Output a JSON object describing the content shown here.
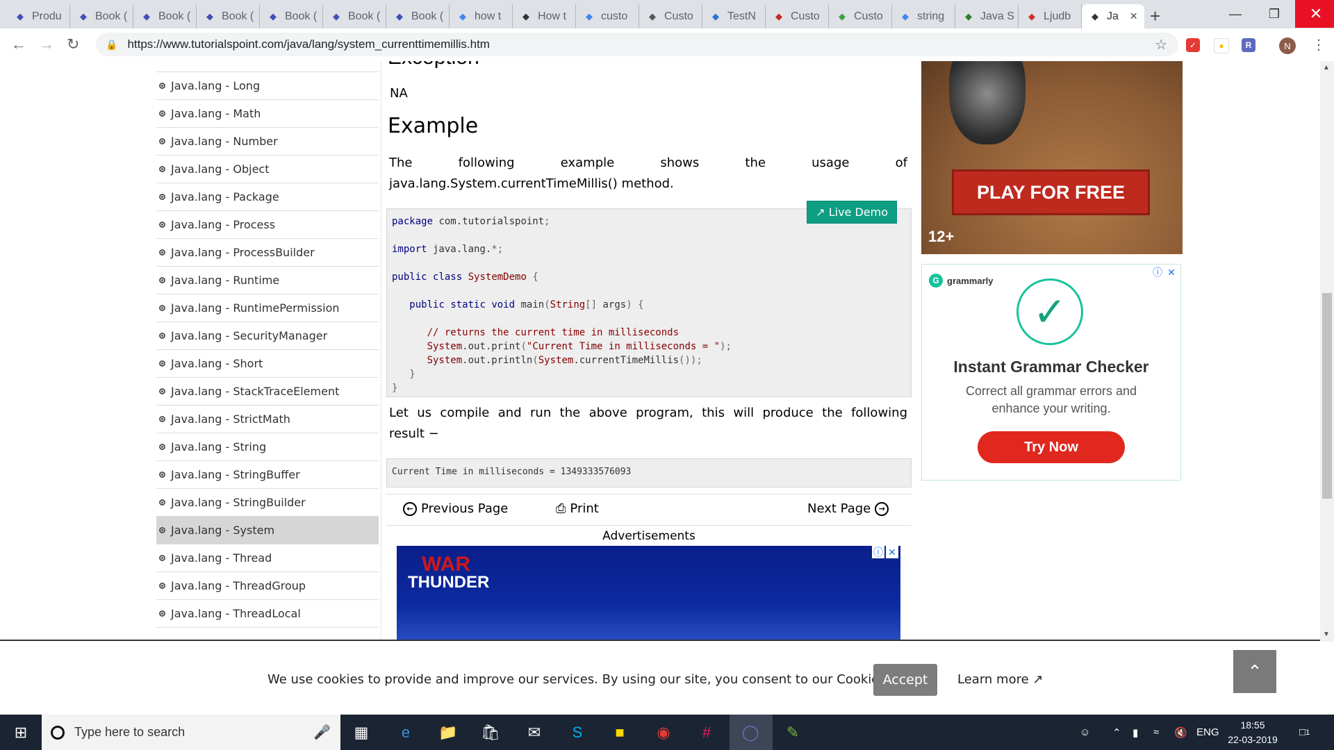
{
  "browser": {
    "tabs": [
      {
        "label": "Produ",
        "icon": "app-icon",
        "color": "#3f51b5"
      },
      {
        "label": "Book (",
        "icon": "app-icon",
        "color": "#3f51b5"
      },
      {
        "label": "Book (",
        "icon": "app-icon",
        "color": "#3f51b5"
      },
      {
        "label": "Book (",
        "icon": "app-icon",
        "color": "#3f51b5"
      },
      {
        "label": "Book (",
        "icon": "app-icon",
        "color": "#3f51b5"
      },
      {
        "label": "Book (",
        "icon": "app-icon",
        "color": "#3f51b5"
      },
      {
        "label": "Book (",
        "icon": "app-icon",
        "color": "#3f51b5"
      },
      {
        "label": "how t",
        "icon": "google-icon",
        "color": "#4285f4"
      },
      {
        "label": "How t",
        "icon": "gear-icon",
        "color": "#333333"
      },
      {
        "label": "custo",
        "icon": "google-icon",
        "color": "#4285f4"
      },
      {
        "label": "Custo",
        "icon": "stack-icon",
        "color": "#555555"
      },
      {
        "label": "TestN",
        "icon": "testng-icon",
        "color": "#2a72d4"
      },
      {
        "label": "Custo",
        "icon": "scroll-icon",
        "color": "#c62828"
      },
      {
        "label": "Custo",
        "icon": "edit-icon",
        "color": "#43a047"
      },
      {
        "label": "string",
        "icon": "google-icon",
        "color": "#4285f4"
      },
      {
        "label": "Java S",
        "icon": "dg-icon",
        "color": "#2e7d32"
      },
      {
        "label": "Ljudb",
        "icon": "n-icon",
        "color": "#d32f2f"
      },
      {
        "label": "Ja",
        "icon": "tutorialspoint-icon",
        "color": "#333333",
        "active": true
      }
    ],
    "url": "https://www.tutorialspoint.com/java/lang/system_currenttimemillis.htm",
    "profile_initial": "N"
  },
  "sidebar": {
    "items": [
      {
        "label": "Java.lang - Long"
      },
      {
        "label": "Java.lang - Math"
      },
      {
        "label": "Java.lang - Number"
      },
      {
        "label": "Java.lang - Object"
      },
      {
        "label": "Java.lang - Package"
      },
      {
        "label": "Java.lang - Process"
      },
      {
        "label": "Java.lang - ProcessBuilder"
      },
      {
        "label": "Java.lang - Runtime"
      },
      {
        "label": "Java.lang - RuntimePermission"
      },
      {
        "label": "Java.lang - SecurityManager"
      },
      {
        "label": "Java.lang - Short"
      },
      {
        "label": "Java.lang - StackTraceElement"
      },
      {
        "label": "Java.lang - StrictMath"
      },
      {
        "label": "Java.lang - String"
      },
      {
        "label": "Java.lang - StringBuffer"
      },
      {
        "label": "Java.lang - StringBuilder"
      },
      {
        "label": "Java.lang - System",
        "active": true
      },
      {
        "label": "Java.lang - Thread"
      },
      {
        "label": "Java.lang - ThreadGroup"
      },
      {
        "label": "Java.lang - ThreadLocal"
      }
    ]
  },
  "main": {
    "exception_heading": "Exception",
    "exception_value": "NA",
    "example_heading": "Example",
    "intro_words": [
      "The",
      "following",
      "example",
      "shows",
      "the",
      "usage",
      "of"
    ],
    "intro_line2": "java.lang.System.currentTimeMillis() method.",
    "live_demo": "Live Demo",
    "result_line1_words": [
      "Let",
      "us",
      "compile",
      "and",
      "run",
      "the",
      "above",
      "program,",
      "this",
      "will",
      "produce",
      "the",
      "following"
    ],
    "result_line2": "result −",
    "output": "Current Time in milliseconds = 1349333576093",
    "prev_page": "Previous Page",
    "print": "Print",
    "next_page": "Next Page",
    "ads_label": "Advertisements"
  },
  "ads": {
    "game_cta": "PLAY FOR FREE",
    "game_age": "12+",
    "war_thunder_line1": "WAR",
    "war_thunder_line2": "THUNDER",
    "grammarly_brand": "grammarly",
    "grammarly_title": "Instant Grammar Checker",
    "grammarly_sub": "Correct all grammar errors and enhance your writing.",
    "grammarly_cta": "Try Now"
  },
  "cookie": {
    "text": "We use cookies to provide and improve our services. By using our site, you consent to our Cookies Policy.",
    "accept": "Accept",
    "learn_more": "Learn more"
  },
  "taskbar": {
    "search_placeholder": "Type here to search",
    "language": "ENG",
    "time": "18:55",
    "date": "22-03-2019",
    "notification_count": "1"
  }
}
